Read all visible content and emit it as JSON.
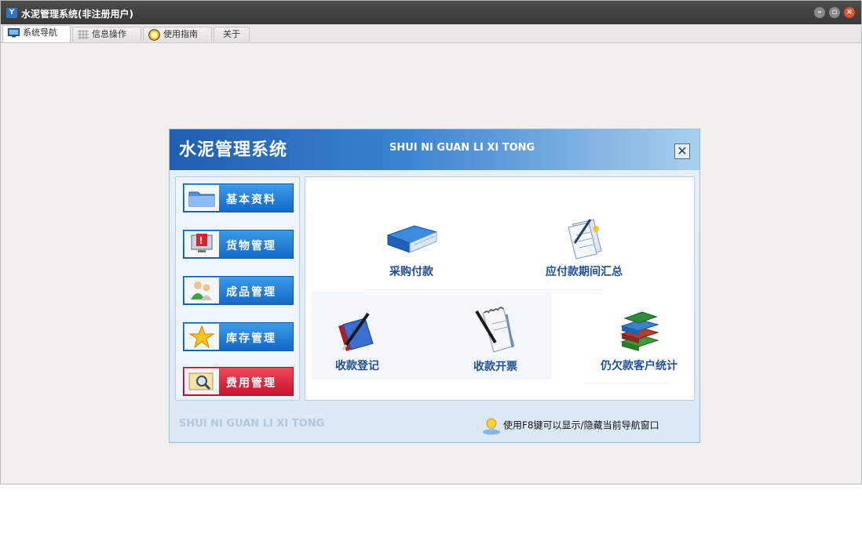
{
  "window": {
    "title": "水泥管理系统(非注册用户)"
  },
  "tabs": [
    {
      "label": "系统导航",
      "icon": "monitor-icon",
      "active": true
    },
    {
      "label": "信息操作",
      "icon": "grid-icon",
      "active": false
    },
    {
      "label": "使用指南",
      "icon": "help-icon",
      "active": false
    },
    {
      "label": "关于",
      "icon": "",
      "active": false
    }
  ],
  "dialog": {
    "title": "水泥管理系统",
    "subtitle": "SHUI NI GUAN LI XI TONG",
    "footer": "SHUI NI GUAN LI XI TONG",
    "hint": "使用F8键可以显示/隐藏当前导航窗口"
  },
  "sidebar": {
    "items": [
      {
        "label": "基本资料",
        "icon": "folder-icon",
        "color": "#1a74d2"
      },
      {
        "label": "货物管理",
        "icon": "alert-monitor-icon",
        "color": "#1a74d2"
      },
      {
        "label": "成品管理",
        "icon": "users-icon",
        "color": "#1a74d2"
      },
      {
        "label": "库存管理",
        "icon": "star-icon",
        "color": "#1a74d2"
      },
      {
        "label": "费用管理",
        "icon": "search-icon",
        "color": "#d81c34"
      }
    ]
  },
  "content": {
    "items": [
      {
        "label": "采购付款",
        "icon": "binder-icon"
      },
      {
        "label": "应付款期间汇总",
        "icon": "document-pen-icon"
      },
      {
        "label": "收款登记",
        "icon": "book-pen-icon"
      },
      {
        "label": "收款开票",
        "icon": "notepad-pen-icon"
      },
      {
        "label": "仍欠款客户统计",
        "icon": "books-stack-icon"
      }
    ]
  }
}
